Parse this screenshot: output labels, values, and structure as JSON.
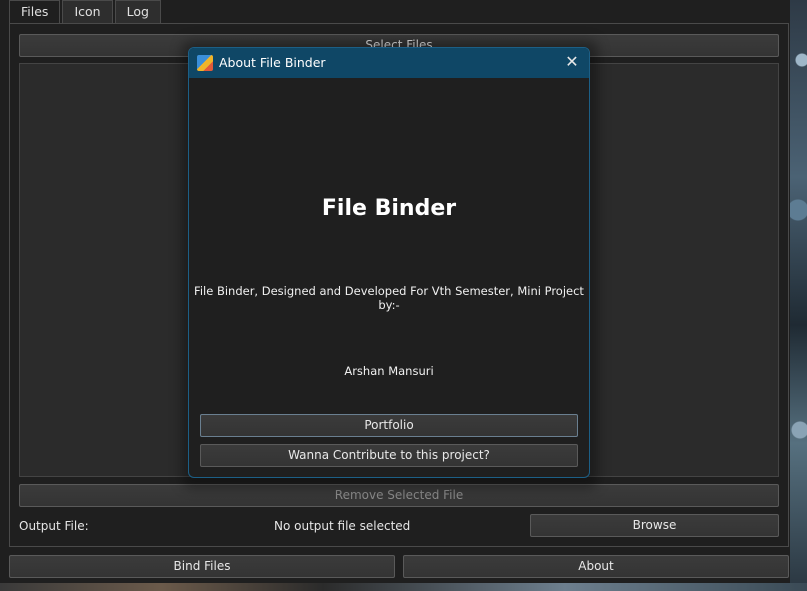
{
  "tabs": [
    {
      "label": "Files",
      "active": true
    },
    {
      "label": "Icon",
      "active": false
    },
    {
      "label": "Log",
      "active": false
    }
  ],
  "files_panel": {
    "select_files_label": "Select Files",
    "remove_selected_label": "Remove Selected File",
    "output_file_label": "Output File:",
    "output_file_value": "No output file selected",
    "browse_label": "Browse"
  },
  "footer": {
    "bind_files_label": "Bind Files",
    "about_label": "About"
  },
  "dialog": {
    "title": "About File Binder",
    "heading": "File Binder",
    "description": "File Binder, Designed and Developed For Vth Semester, Mini Project by:-",
    "author": "Arshan Mansuri",
    "portfolio_label": "Portfolio",
    "contribute_label": "Wanna Contribute to this project?",
    "close_icon": "close-icon"
  },
  "colors": {
    "title_bar": "#0f4766",
    "dialog_border": "#1c5f86",
    "background": "#1f1f1f",
    "button": "#3b3b3b"
  }
}
